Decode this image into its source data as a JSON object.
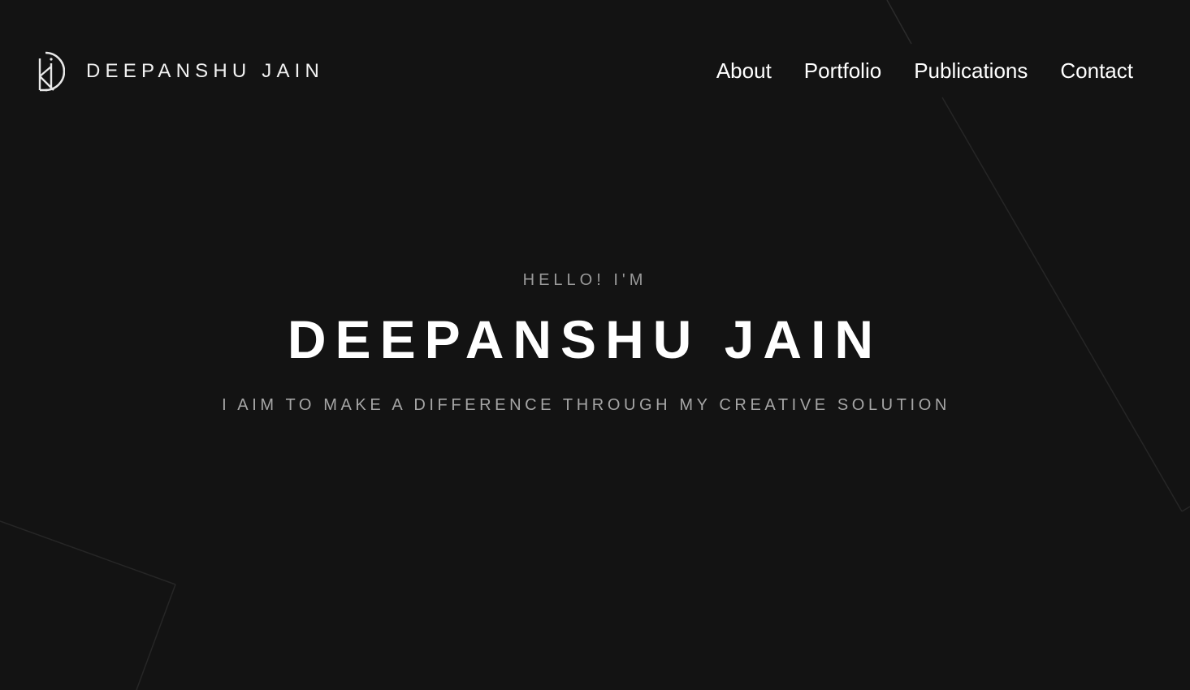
{
  "header": {
    "brand_name": "DEEPANSHU JAIN",
    "logo_icon": "dj-monogram-icon",
    "nav": [
      {
        "label": "About"
      },
      {
        "label": "Portfolio"
      },
      {
        "label": "Publications"
      },
      {
        "label": "Contact"
      }
    ]
  },
  "hero": {
    "greeting": "HELLO! I'M",
    "title": "DEEPANSHU JAIN",
    "tagline": "I AIM TO MAKE A DIFFERENCE THROUGH MY CREATIVE SOLUTION"
  },
  "colors": {
    "background": "#131313",
    "text": "#ffffff",
    "muted_text": "#a6a6a6",
    "decor_lines": "#2a2a2a"
  }
}
